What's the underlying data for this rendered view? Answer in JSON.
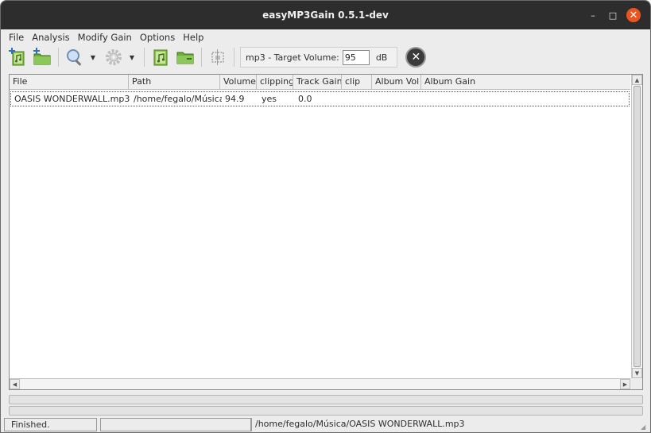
{
  "window": {
    "title": "easyMP3Gain 0.5.1-dev",
    "min_glyph": "–",
    "max_glyph": "□",
    "close_glyph": "✕"
  },
  "menu": [
    "File",
    "Analysis",
    "Modify Gain",
    "Options",
    "Help"
  ],
  "toolbar": {
    "target_label": "mp3 - Target Volume:",
    "target_value": "95",
    "target_unit": "dB",
    "arrow_glyph": "▼",
    "stop_glyph": "✕",
    "icons": [
      "add-file-icon",
      "add-folder-icon",
      "analyze-icon",
      "gain-settings-icon",
      "add-file-icon",
      "add-folder-icon",
      "select-all-icon",
      "stop-icon"
    ]
  },
  "table": {
    "columns": [
      "File",
      "Path",
      "Volume",
      "clipping",
      "Track Gain",
      "clip",
      "Album Vol",
      "Album Gain"
    ],
    "rows": [
      [
        "OASIS WONDERWALL.mp3",
        "/home/fegalo/Música",
        "94.9",
        "yes",
        "0.0",
        "",
        "",
        ""
      ]
    ]
  },
  "scroll_glyphs": {
    "up": "▲",
    "down": "▼",
    "left": "◀",
    "right": "▶"
  },
  "progress": {
    "file": 0,
    "total": 0
  },
  "status": {
    "left": "Finished.",
    "right": "/home/fegalo/Música/OASIS WONDERWALL.mp3"
  },
  "colors": {
    "titlebar": "#2d2d2d",
    "close_button": "#e95420",
    "icon_green": "#6cae3a",
    "stop_button": "#3b3b3b"
  }
}
